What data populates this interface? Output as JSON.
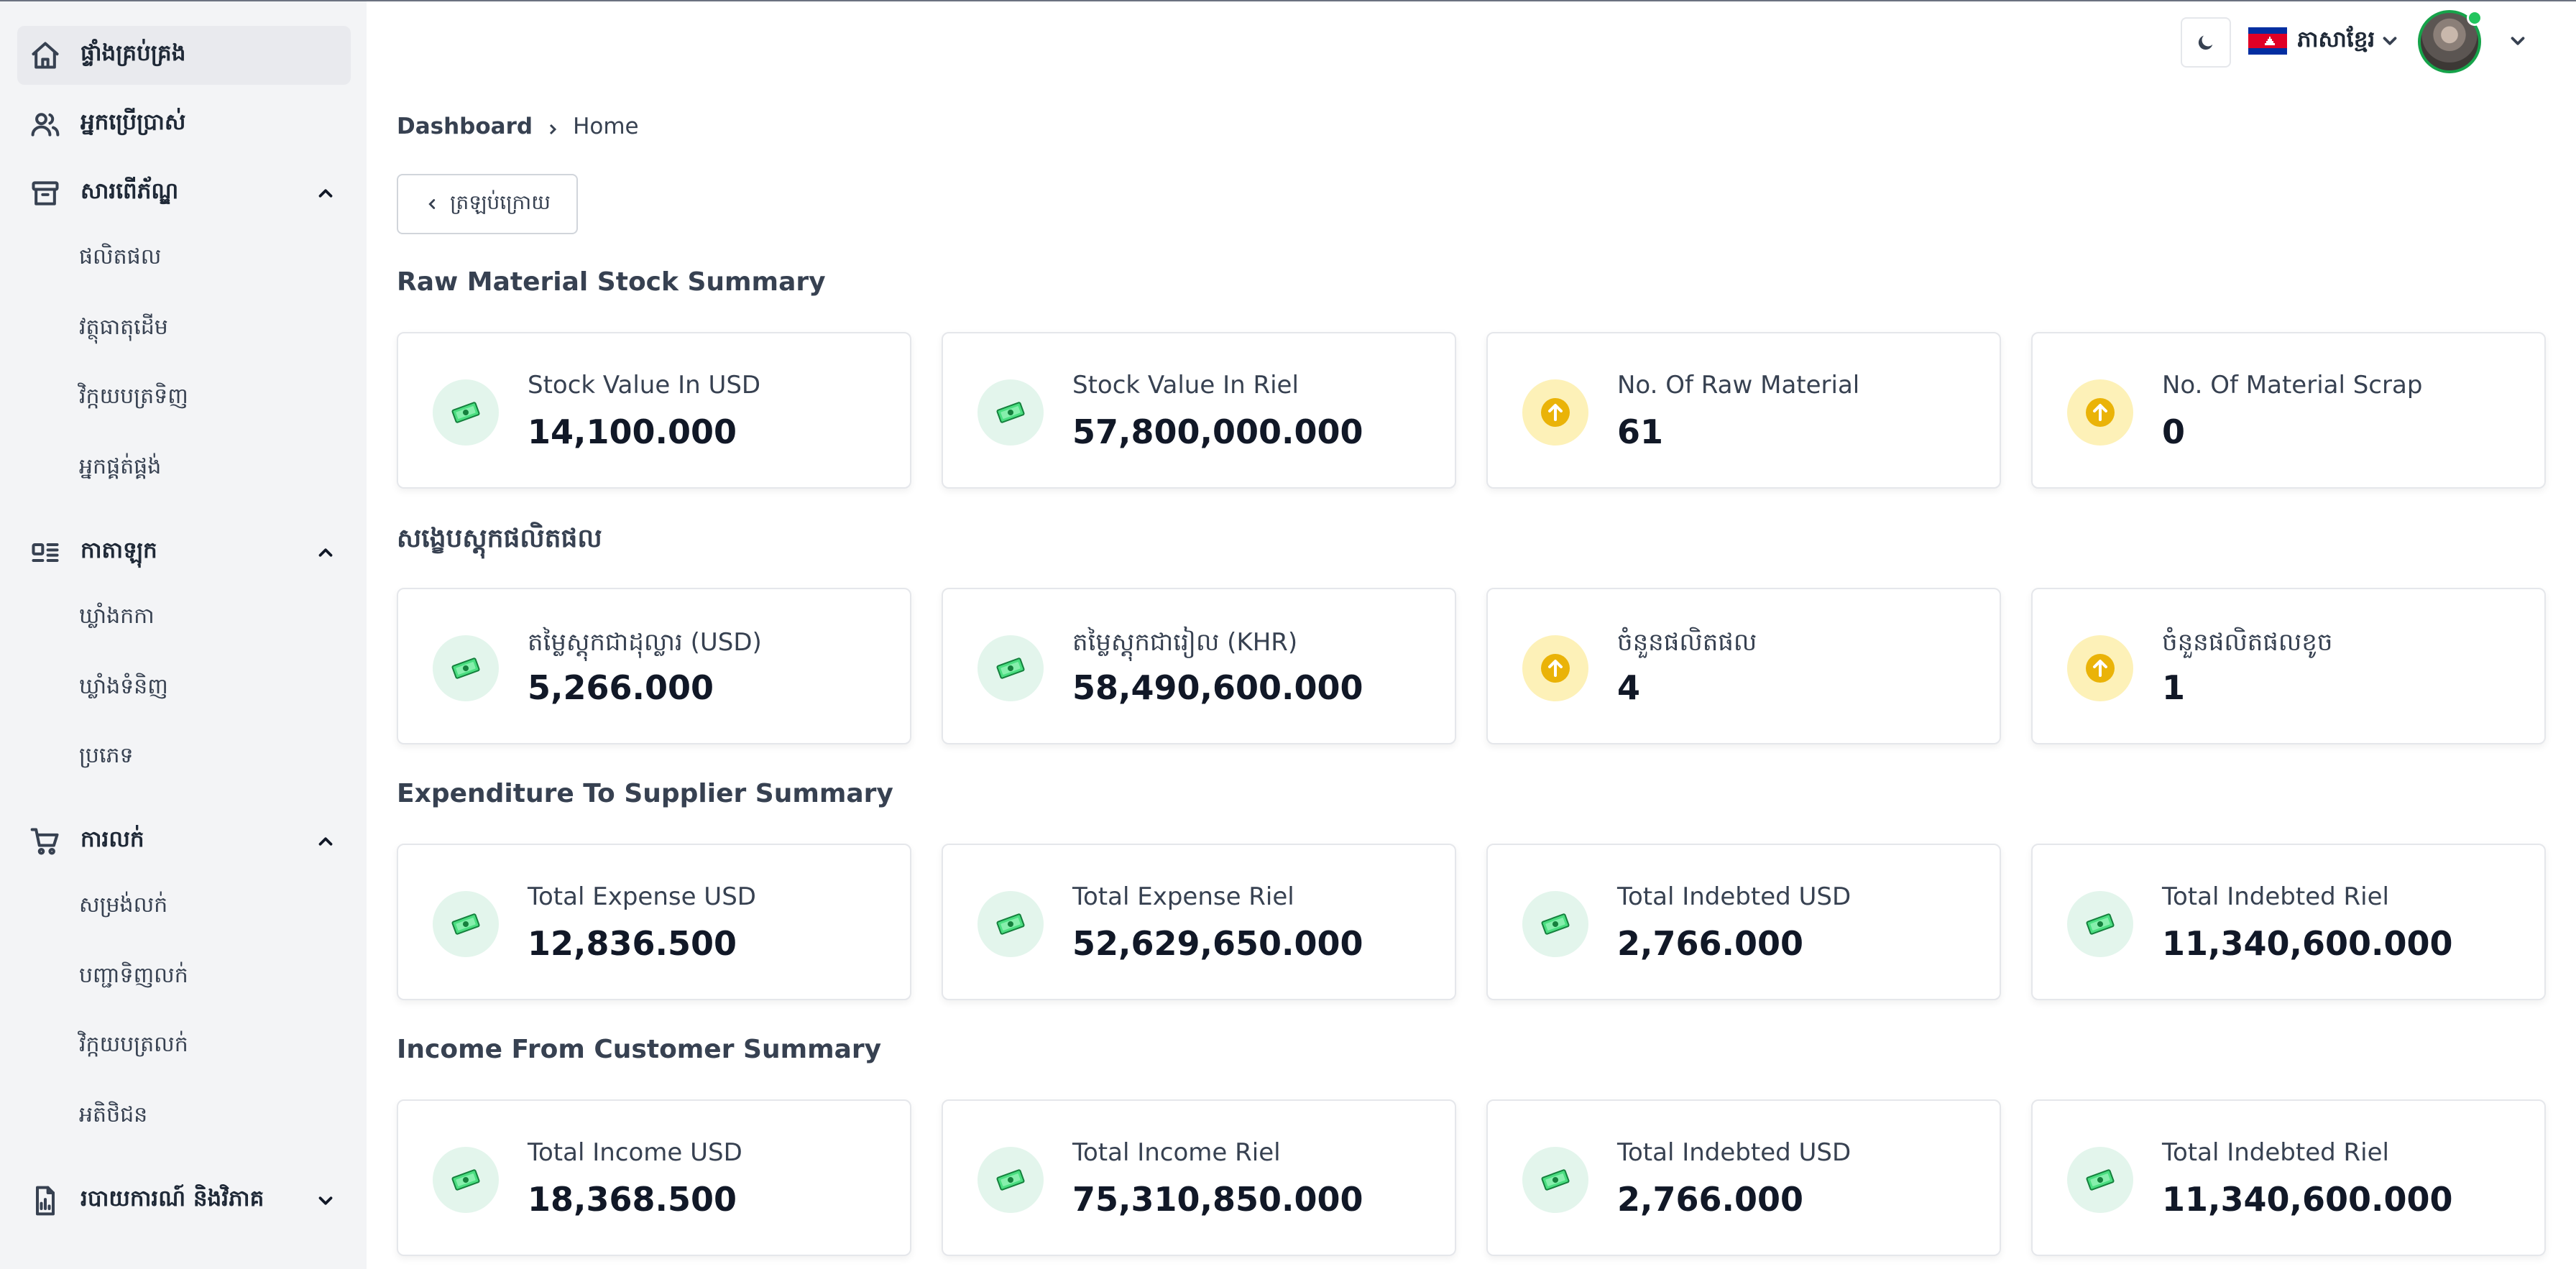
{
  "sidebar": {
    "items": [
      {
        "label": "ផ្ទាំងគ្រប់គ្រង",
        "icon": "home-icon"
      },
      {
        "label": "អ្នកប្រើប្រាស់",
        "icon": "users-icon"
      },
      {
        "label": "សារពើភ័ណ្ឌ",
        "icon": "archive-icon",
        "sub": [
          "ផលិតផល",
          "វត្ថុធាតុដើម",
          "វិក្កយបត្រទិញ",
          "អ្នកផ្គត់ផ្គង់"
        ]
      },
      {
        "label": "កាតាឡុក",
        "icon": "catalog-icon",
        "sub": [
          "ឃ្លាំងកកា",
          "ឃ្លាំងទំនិញ",
          "ប្រភេទ"
        ]
      },
      {
        "label": "ការលក់",
        "icon": "cart-icon",
        "sub": [
          "សម្រង់លក់",
          "បញ្ជាទិញលក់",
          "វិក្កយបត្រលក់",
          "អតិថិជន"
        ]
      },
      {
        "label": "របាយការណ៍ និងវិភាគ",
        "icon": "report-icon"
      }
    ]
  },
  "header": {
    "language": "ភាសាខ្មែរ",
    "flag_colors": {
      "blue": "#032EA1",
      "red": "#E00025",
      "white": "#ffffff"
    }
  },
  "breadcrumb": {
    "root": "Dashboard",
    "current": "Home"
  },
  "back_button": "ត្រឡប់ក្រោយ",
  "sections": [
    {
      "title": "Raw Material Stock Summary",
      "cards": [
        {
          "icon": "money-icon",
          "label": "Stock Value In USD",
          "value": "14,100.000"
        },
        {
          "icon": "money-icon",
          "label": "Stock Value In Riel",
          "value": "57,800,000.000"
        },
        {
          "icon": "arrow-up-icon",
          "label": "No. Of Raw Material",
          "value": "61"
        },
        {
          "icon": "arrow-up-icon",
          "label": "No. Of Material Scrap",
          "value": "0"
        }
      ]
    },
    {
      "title": "សង្ខេបស្តុកផលិតផល",
      "cards": [
        {
          "icon": "money-icon",
          "label": "តម្លៃស្តុកជាដុល្លារ (USD)",
          "value": "5,266.000"
        },
        {
          "icon": "money-icon",
          "label": "តម្លៃស្តុកជារៀល (KHR)",
          "value": "58,490,600.000"
        },
        {
          "icon": "arrow-up-icon",
          "label": "ចំនួនផលិតផល",
          "value": "4"
        },
        {
          "icon": "arrow-up-icon",
          "label": "ចំនួនផលិតផលខូច",
          "value": "1"
        }
      ]
    },
    {
      "title": "Expenditure To Supplier Summary",
      "cards": [
        {
          "icon": "money-icon",
          "label": "Total Expense USD",
          "value": "12,836.500"
        },
        {
          "icon": "money-icon",
          "label": "Total Expense Riel",
          "value": "52,629,650.000"
        },
        {
          "icon": "money-icon",
          "label": "Total Indebted USD",
          "value": "2,766.000"
        },
        {
          "icon": "money-icon",
          "label": "Total Indebted Riel",
          "value": "11,340,600.000"
        }
      ]
    },
    {
      "title": "Income From Customer Summary",
      "cards": [
        {
          "icon": "money-icon",
          "label": "Total Income USD",
          "value": "18,368.500"
        },
        {
          "icon": "money-icon",
          "label": "Total Income Riel",
          "value": "75,310,850.000"
        },
        {
          "icon": "money-icon",
          "label": "Total Indebted USD",
          "value": "2,766.000"
        },
        {
          "icon": "money-icon",
          "label": "Total Indebted Riel",
          "value": "11,340,600.000"
        }
      ]
    }
  ]
}
